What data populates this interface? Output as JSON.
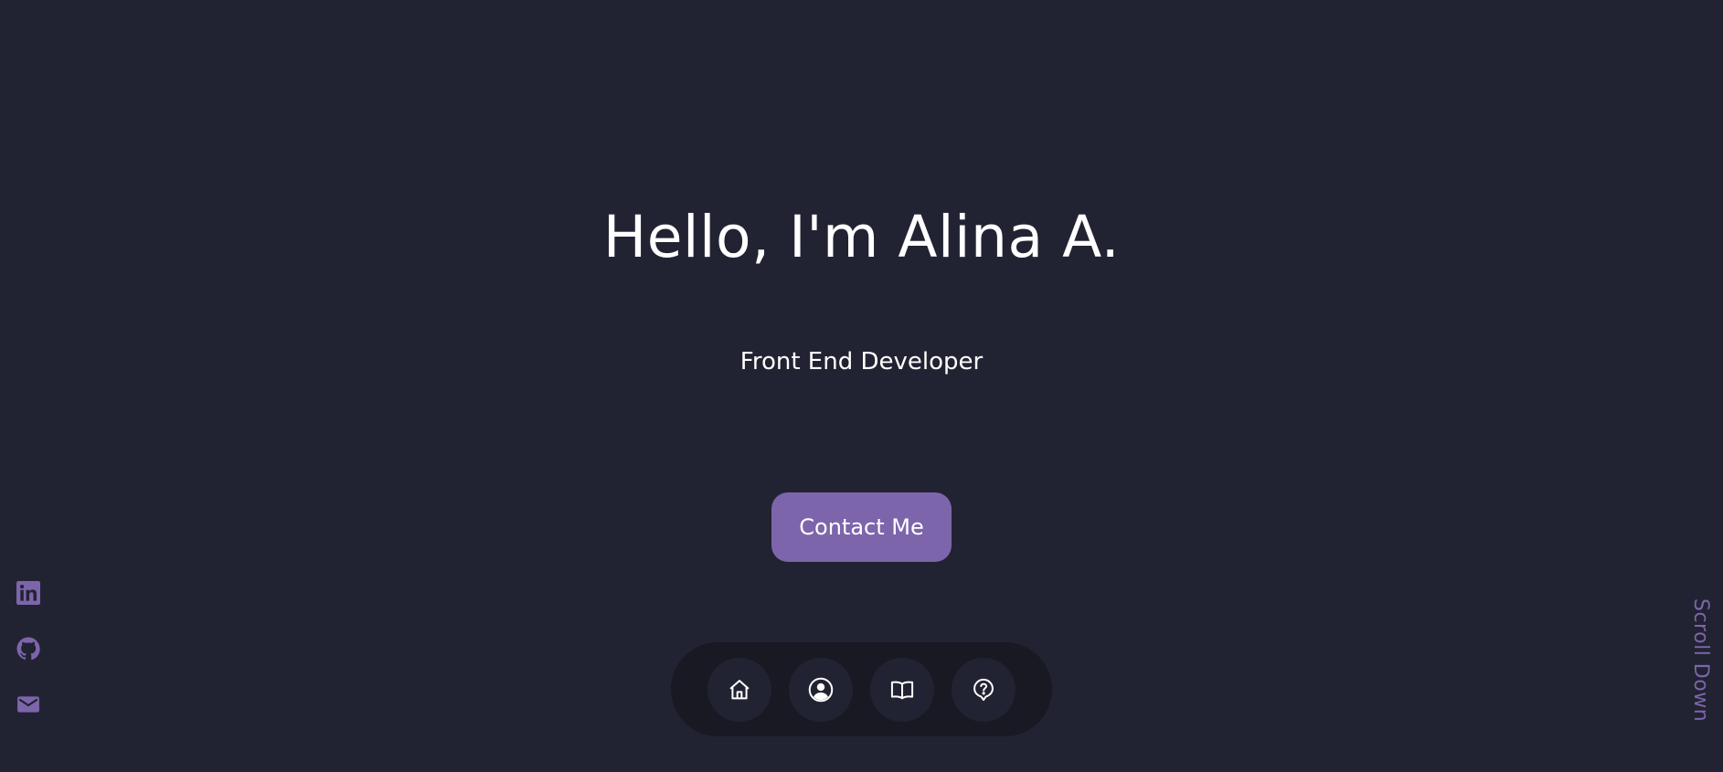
{
  "hero": {
    "greeting": "Hello, I'm Alina A.",
    "role": "Front End Developer",
    "contact_label": "Contact Me"
  },
  "social": [
    {
      "icon": "linkedin-icon"
    },
    {
      "icon": "github-icon"
    },
    {
      "icon": "mail-icon"
    }
  ],
  "scroll_down_label": "Scroll Down",
  "dock": [
    {
      "icon": "home-icon"
    },
    {
      "icon": "user-icon"
    },
    {
      "icon": "book-icon"
    },
    {
      "icon": "question-icon"
    }
  ],
  "colors": {
    "background": "#222332",
    "dock_background": "#181922",
    "accent": "#7d65ab",
    "text": "#ffffff"
  }
}
